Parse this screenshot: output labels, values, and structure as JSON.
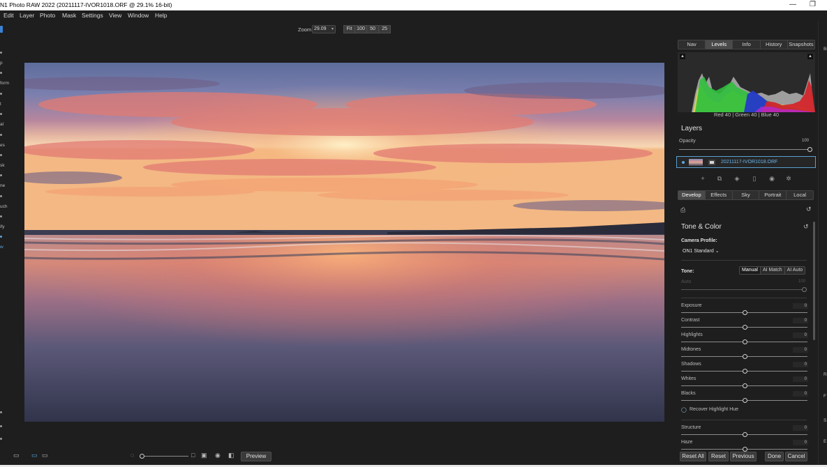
{
  "window": {
    "title": "N1 Photo RAW 2022 (20211117-IVOR1018.ORF @ 29.1% 16-bit)",
    "minimize_icon": "minimize-icon",
    "maximize_icon": "restore-icon",
    "minimize_glyph": "—",
    "restore_glyph": "❐"
  },
  "menu": [
    {
      "label": "Edit"
    },
    {
      "label": "Layer"
    },
    {
      "label": "Photo"
    },
    {
      "label": "Mask"
    },
    {
      "label": "Settings"
    },
    {
      "label": "View"
    },
    {
      "label": "Window"
    },
    {
      "label": "Help"
    }
  ],
  "left_rail": {
    "labels": [
      "p",
      "form",
      "t",
      "al",
      "es",
      "sk",
      "ne",
      "uch",
      "ify",
      "w"
    ]
  },
  "zoom": {
    "label": "Zoom",
    "value": "29.09",
    "buttons": [
      "Fit",
      "100",
      "50",
      "25"
    ]
  },
  "panel_tabs": [
    "Nav",
    "Levels",
    "Info",
    "History",
    "Snapshots"
  ],
  "panel_tabs_active": "Levels",
  "histogram": {
    "readout": "Red  40   | Green  40   | Blue  40"
  },
  "layers": {
    "title": "Layers",
    "opacity_label": "Opacity",
    "opacity_value": "100",
    "opacity_level": 1.0,
    "layer_name": "20211117-IVOR1018.ORF"
  },
  "module_tabs": [
    "Develop",
    "Effects",
    "Sky",
    "Portrait",
    "Local"
  ],
  "module_tabs_active": "Develop",
  "tone_color": {
    "title": "Tone & Color",
    "camera_profile_label": "Camera Profile:",
    "camera_profile_value": "ON1 Standard",
    "tone_label": "Tone:",
    "tone_modes": [
      "Manual",
      "AI Match",
      "AI Auto"
    ],
    "tone_mode_active": "Manual",
    "auto_label": "Auto",
    "auto_value": "100",
    "sliders": [
      {
        "label": "Exposure",
        "value": "0",
        "level": 0.5
      },
      {
        "label": "Contrast",
        "value": "0",
        "level": 0.5
      },
      {
        "label": "Highlights",
        "value": "0",
        "level": 0.5
      },
      {
        "label": "Midtones",
        "value": "0",
        "level": 0.5
      },
      {
        "label": "Shadows",
        "value": "0",
        "level": 0.5
      },
      {
        "label": "Whites",
        "value": "0",
        "level": 0.5
      },
      {
        "label": "Blacks",
        "value": "0",
        "level": 0.5
      }
    ],
    "recover_highlight_label": "Recover Highlight Hue",
    "sliders2": [
      {
        "label": "Structure",
        "value": "0",
        "level": 0.5
      },
      {
        "label": "Haze",
        "value": "0",
        "level": 0.5
      }
    ]
  },
  "bottom": {
    "preview_label": "Preview",
    "buttons": [
      "Reset All",
      "Reset",
      "Previous",
      "Done",
      "Cancel"
    ]
  },
  "right_edge": {
    "labels": [
      "Br",
      "R",
      "F",
      "S",
      "E"
    ]
  },
  "colors": {
    "accent": "#3a83d6",
    "layer_name": "#6ab4e8",
    "panel_bg": "#1e1e1e"
  }
}
